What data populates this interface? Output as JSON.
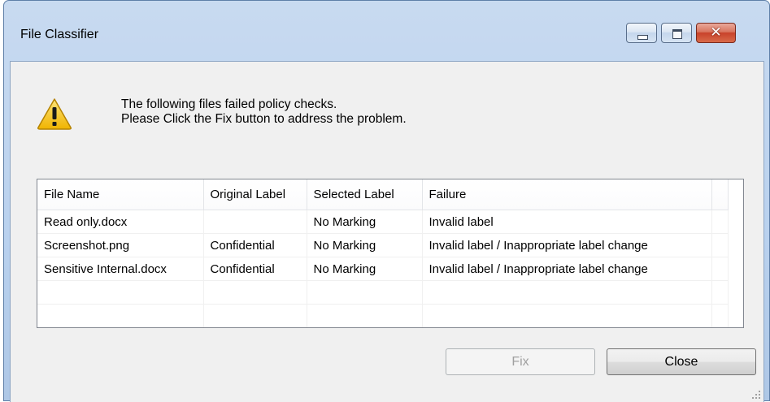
{
  "window": {
    "title": "File Classifier"
  },
  "message": {
    "line1": "The following files failed policy checks.",
    "line2": "Please Click the Fix button to address the problem."
  },
  "table": {
    "columns": [
      "File Name",
      "Original Label",
      "Selected Label",
      "Failure"
    ],
    "rows": [
      [
        "Read only.docx",
        "",
        "No Marking",
        "Invalid label"
      ],
      [
        "Screenshot.png",
        "Confidential",
        "No Marking",
        "Invalid label / Inappropriate label change"
      ],
      [
        "Sensitive Internal.docx",
        "Confidential",
        "No Marking",
        "Invalid label / Inappropriate label change"
      ]
    ]
  },
  "buttons": {
    "fix": "Fix",
    "close": "Close"
  },
  "icons": {
    "warning": "warning-icon",
    "minimize": "minimize-icon",
    "maximize": "maximize-icon",
    "close": "close-icon"
  },
  "colors": {
    "close_button": "#c8422a",
    "warning_fill": "#f5c518"
  }
}
